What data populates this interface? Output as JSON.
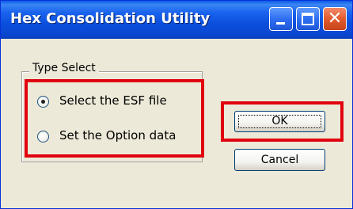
{
  "window": {
    "title": "Hex Consolidation Utility"
  },
  "titlebar_buttons": {
    "minimize_icon": "minimize-icon",
    "maximize_icon": "maximize-icon",
    "close_icon": "close-icon",
    "close_glyph": "✕"
  },
  "group": {
    "label": "Type Select",
    "options": [
      {
        "label": "Select the ESF file",
        "selected": true
      },
      {
        "label": "Set the Option data",
        "selected": false
      }
    ]
  },
  "buttons": {
    "ok_label": "OK",
    "cancel_label": "Cancel"
  },
  "colors": {
    "titlebar": "#0b4fdc",
    "highlight": "#e0000e",
    "face": "#ece9d8"
  }
}
